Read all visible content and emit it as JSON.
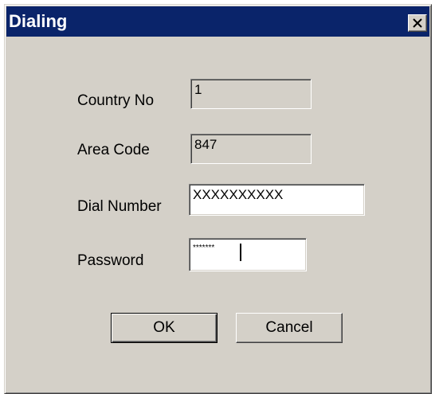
{
  "window": {
    "title": "Dialing"
  },
  "fields": {
    "country_no": {
      "label": "Country No",
      "value": "1"
    },
    "area_code": {
      "label": "Area Code",
      "value": "847"
    },
    "dial_number": {
      "label": "Dial Number",
      "value": "XXXXXXXXXX"
    },
    "password": {
      "label": "Password",
      "value": "*******"
    }
  },
  "buttons": {
    "ok": "OK",
    "cancel": "Cancel"
  },
  "icons": {
    "close": "close-icon"
  },
  "colors": {
    "titlebar": "#0a246a",
    "face": "#d4d0c8"
  }
}
